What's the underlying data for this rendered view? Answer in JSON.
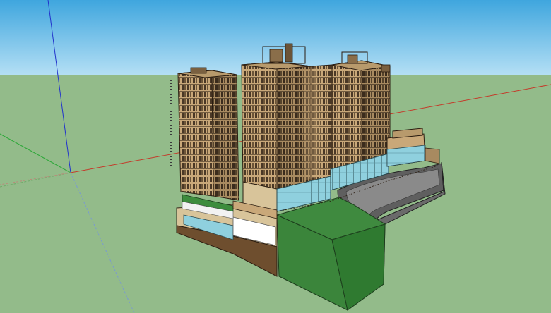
{
  "viewport": {
    "sky_top_color": "#3fa6de",
    "sky_bottom_color": "#b6e0f5",
    "ground_color": "#93bb8a",
    "axis_blue": "#2233cc",
    "axis_red": "#c43a2a",
    "axis_green": "#2fa83a"
  },
  "model": {
    "facade_color": "#c9a879",
    "facade_dark_color": "#5b4630",
    "glass_color": "#8fd0de",
    "podium_green": "#3f8a3f",
    "road_color": "#5f5f5f"
  }
}
